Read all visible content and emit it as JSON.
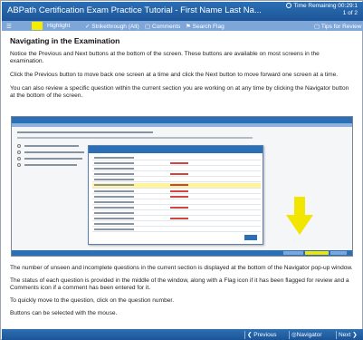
{
  "window": {
    "title": "ABPath Certification Exam Practice Tutorial - First Name Last Na...",
    "timer_label": "Time Remaining 00:29:1",
    "timer_sub": "1 of 2"
  },
  "toolbar": {
    "highlight": "Highlight",
    "strikethrough": "Strikethrough (Alt)",
    "comments": "Comments",
    "search_flag": "Search Flag",
    "tips": "Tips for Review"
  },
  "content": {
    "heading": "Navigating in the Examination",
    "p1": "Notice the Previous and Next buttons at the bottom of the screen. These buttons are available on most screens in the examination.",
    "p2": "Click the Previous button to move back one screen at a time and click the Next button to move forward one screen at a time.",
    "p3": "You can also review a specific question within the current section you are working on at any time by clicking the Navigator button at the bottom of the screen.",
    "p4": "The number of unseen and incomplete questions in the current section is displayed at the bottom of the Navigator pop-up window.",
    "p5": "The status of each question is provided in the middle of the window, along with a Flag icon if it has been flagged for review and a Comments icon if a comment has been entered for it.",
    "p6": "To quickly move to the question, click on the question number.",
    "p7": "Buttons can be selected with the mouse."
  },
  "nav": {
    "previous": "Previous",
    "navigator": "Navigator",
    "next": "Next"
  },
  "colors": {
    "titlebar": "#1c5597",
    "toolbar": "#7ea6d9",
    "highlight_yellow": "#f5ec00",
    "arrow_yellow": "#f2e600"
  }
}
